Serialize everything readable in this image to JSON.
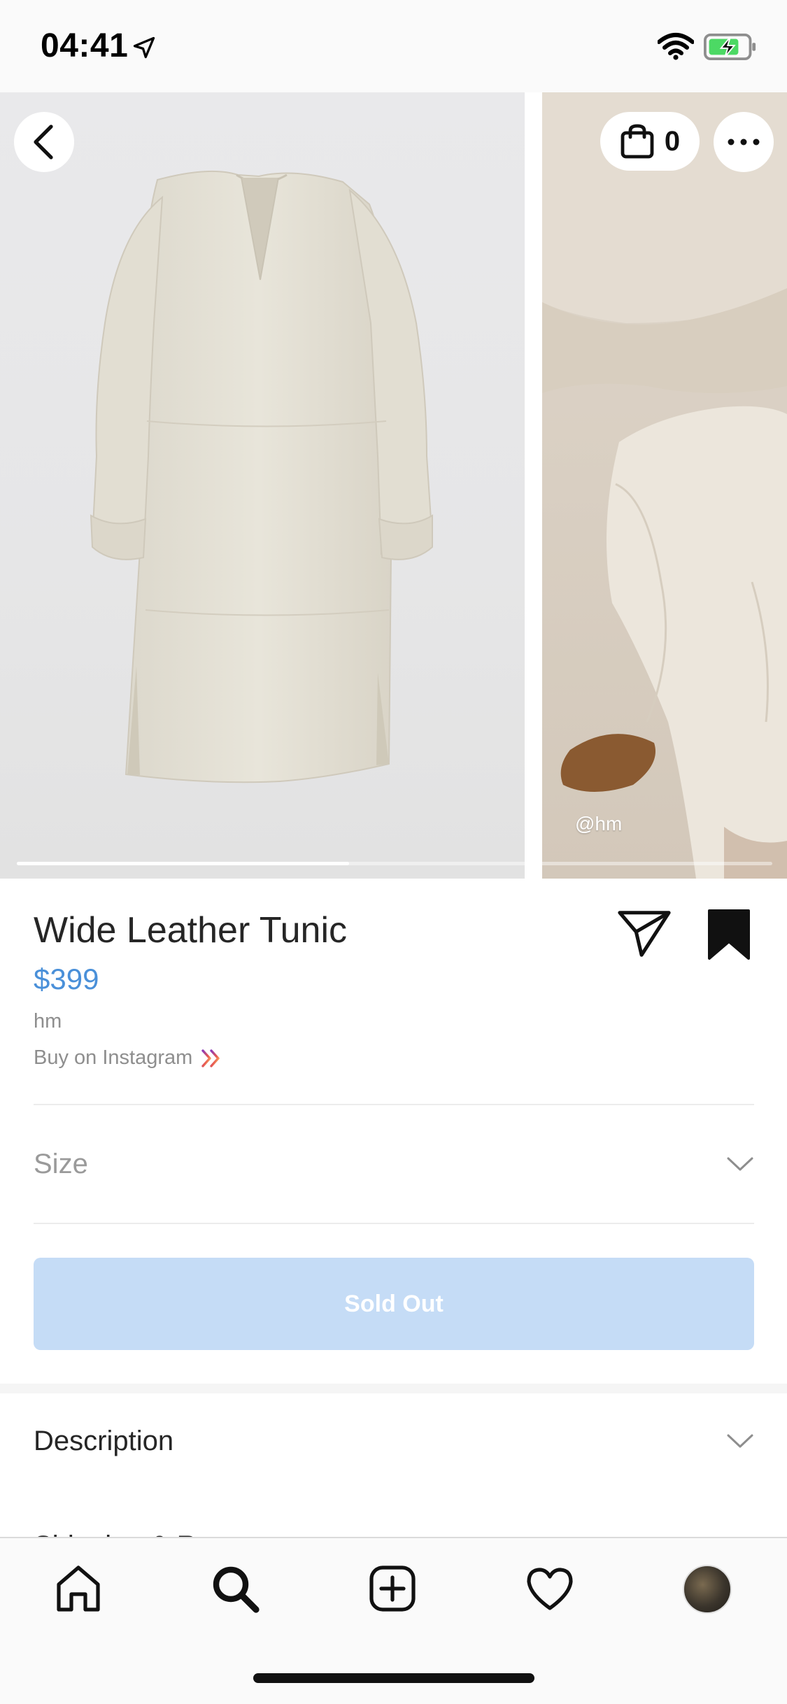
{
  "status_bar": {
    "time": "04:41"
  },
  "product_media": {
    "caption": "@hm",
    "image_position_fraction": 0.44
  },
  "header": {
    "bag_count": "0"
  },
  "product": {
    "title": "Wide Leather Tunic",
    "price": "$399",
    "merchant": "hm",
    "buy_link": "Buy on Instagram"
  },
  "size": {
    "label": "Size"
  },
  "action": {
    "sold_out_label": "Sold Out"
  },
  "sections": {
    "description": "Description",
    "shipping": "Shipping & Returns"
  },
  "colors": {
    "price": "#4a90d9",
    "sold_out_bg": "#c5dcf6",
    "buy_link_gradient": [
      "#8a3ab9",
      "#e95950",
      "#fccc63"
    ]
  },
  "icons": {
    "status": [
      "location-arrow-icon",
      "wifi-icon",
      "battery-charging-icon"
    ],
    "header": [
      "back-chevron-icon",
      "shopping-bag-icon",
      "more-dots-icon"
    ],
    "product": [
      "share-paper-plane-icon",
      "bookmark-filled-icon",
      "double-chevron-right-icon"
    ],
    "tabs": [
      "home-icon",
      "search-icon",
      "new-post-icon",
      "heart-icon",
      "profile-avatar"
    ]
  }
}
